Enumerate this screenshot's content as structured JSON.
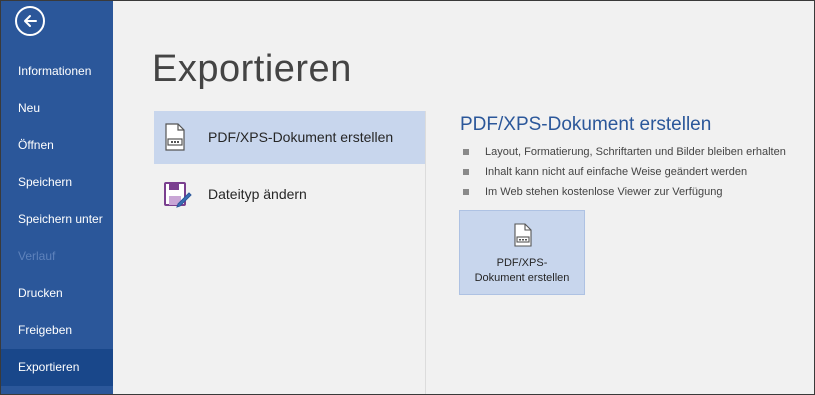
{
  "sidebar": {
    "back_icon": "back-arrow-icon",
    "items": [
      {
        "label": "Informationen"
      },
      {
        "label": "Neu"
      },
      {
        "label": "Öffnen"
      },
      {
        "label": "Speichern"
      },
      {
        "label": "Speichern unter"
      },
      {
        "label": "Verlauf",
        "disabled": true
      },
      {
        "label": "Drucken"
      },
      {
        "label": "Freigeben"
      },
      {
        "label": "Exportieren",
        "active": true
      }
    ],
    "bg_color": "#2b579a",
    "active_color": "#19478a"
  },
  "page": {
    "title": "Exportieren"
  },
  "options": [
    {
      "label": "PDF/XPS-Dokument erstellen",
      "icon": "pdf-document-icon",
      "selected": true
    },
    {
      "label": "Dateityp ändern",
      "icon": "change-file-type-icon",
      "selected": false
    }
  ],
  "detail": {
    "title": "PDF/XPS-Dokument erstellen",
    "bullets": [
      "Layout, Formatierung, Schriftarten und Bilder bleiben erhalten",
      "Inhalt kann nicht auf einfache Weise geändert werden",
      "Im Web stehen kostenlose Viewer zur Verfügung"
    ],
    "button_label": "PDF/XPS-\nDokument erstellen",
    "button_icon": "pdf-document-icon"
  },
  "colors": {
    "accent": "#2b579a",
    "selection": "#c8d6ed",
    "background": "#f1f1f1"
  }
}
